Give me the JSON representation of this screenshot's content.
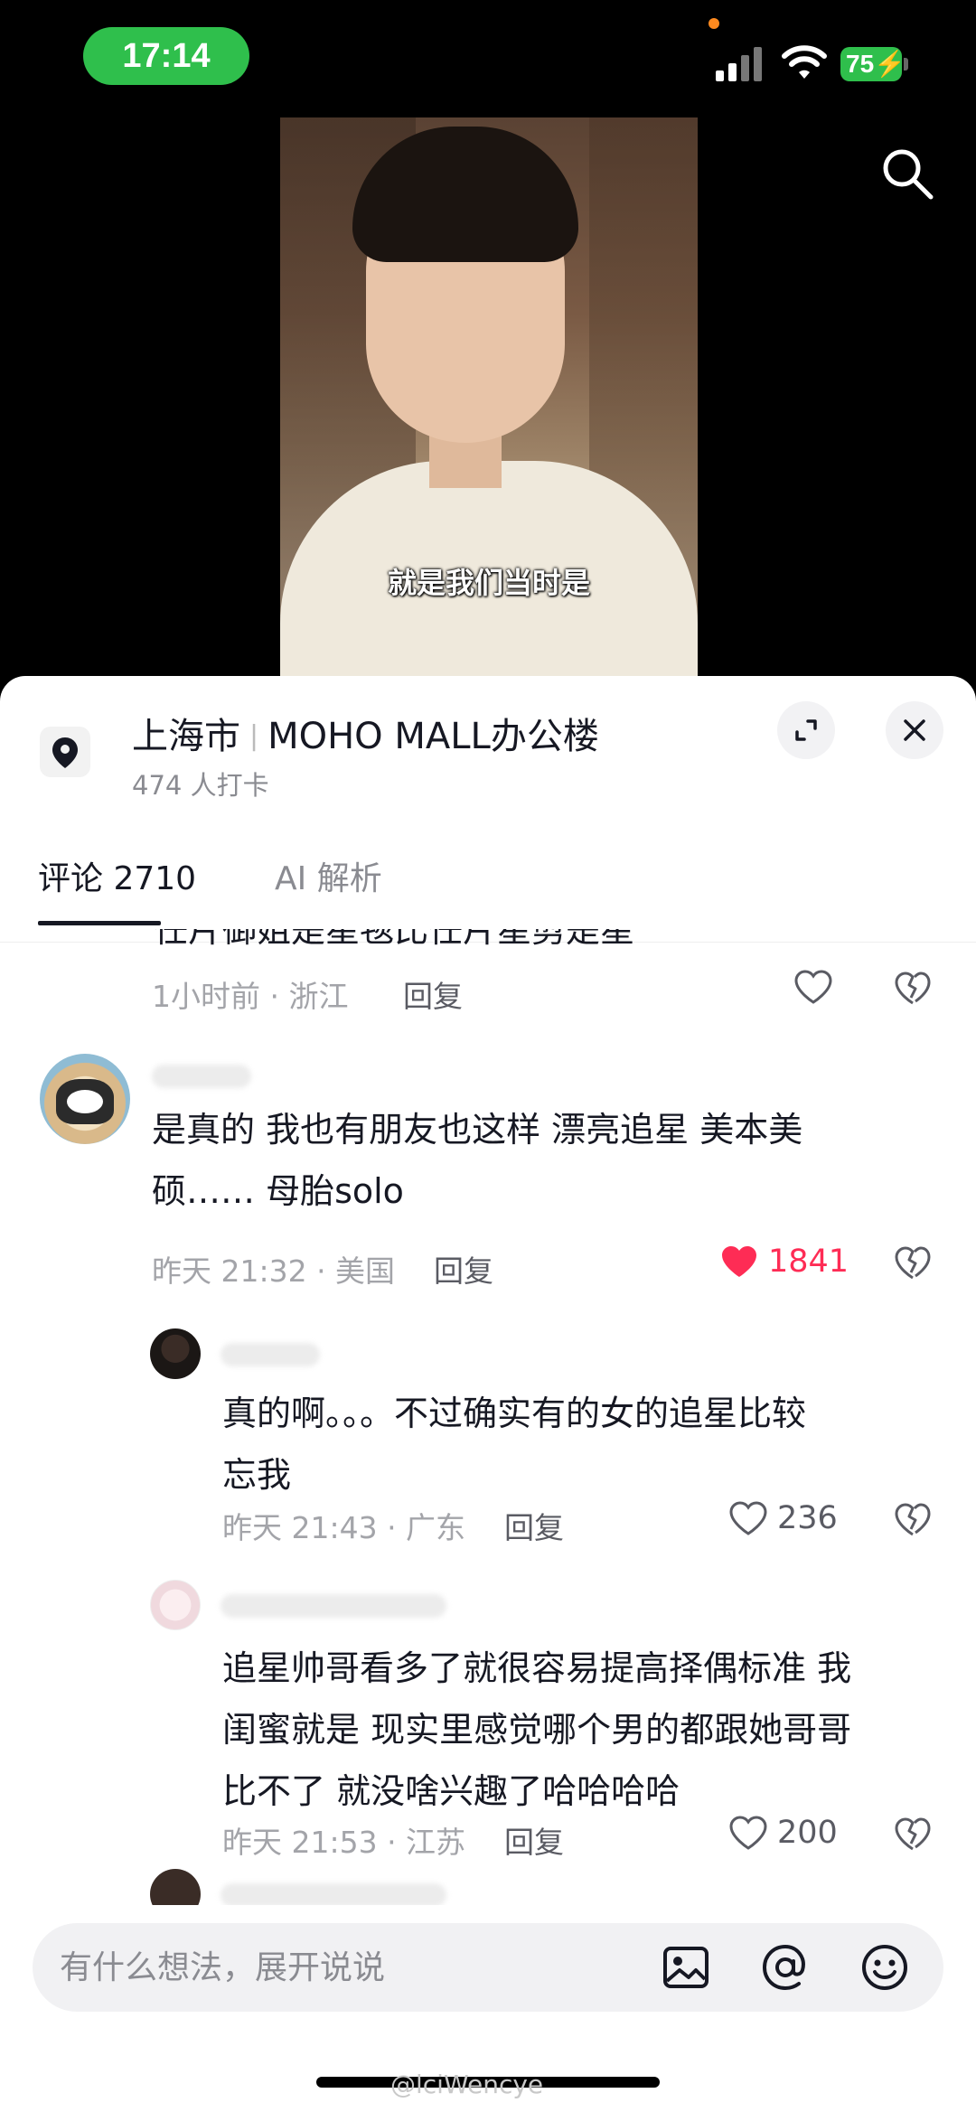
{
  "status_bar": {
    "time": "17:14",
    "battery": "75"
  },
  "video": {
    "subtitle": "就是我们当时是"
  },
  "location": {
    "city": "上海市",
    "place": "MOHO MALL办公楼",
    "checkins": "474 人打卡"
  },
  "tabs": {
    "comments": "评论 2710",
    "ai": "AI 解析"
  },
  "comments": [
    {
      "text_partial": "任片御姐是星毯比任片星剪是星",
      "time": "1小时前 · 浙江",
      "reply": "回复",
      "likes": ""
    },
    {
      "line1": "是真的 我也有朋友也这样 漂亮追星 美本美",
      "line2": "硕…… 母胎solo",
      "time": "昨天 21:32 · 美国",
      "reply": "回复",
      "likes": "1841",
      "liked": true
    }
  ],
  "replies": [
    {
      "line1": "真的啊。。。不过确实有的女的追星比较",
      "line2": "忘我",
      "time": "昨天 21:43 · 广东",
      "reply": "回复",
      "likes": "236"
    },
    {
      "line1": "追星帅哥看多了就很容易提高择偶标准 我",
      "line2": "闺蜜就是 现实里感觉哪个男的都跟她哥哥",
      "line3": "比不了 就没啥兴趣了哈哈哈哈",
      "time": "昨天 21:53 · 江苏",
      "reply": "回复",
      "likes": "200"
    }
  ],
  "input": {
    "placeholder": "有什么想法，展开说说"
  },
  "watermark": "@lciWencye",
  "colors": {
    "status_green": "#2fbf4c",
    "like_red": "#fe2c55",
    "text_primary": "#161823",
    "text_secondary": "#a3a4a9"
  },
  "icons": [
    "search-icon",
    "location-pin-icon",
    "expand-icon",
    "close-icon",
    "heart-icon",
    "dislike-icon",
    "image-icon",
    "at-icon",
    "emoji-icon",
    "signal-icon",
    "wifi-icon"
  ]
}
